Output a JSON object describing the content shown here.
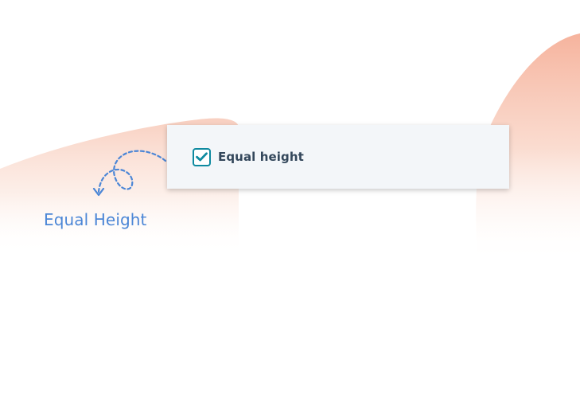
{
  "control": {
    "label": "Equal height",
    "checked": true
  },
  "caption": "Equal Height",
  "colors": {
    "accent": "#0e8aa0",
    "label_text": "#33475b",
    "caption": "#4b86d6",
    "panel_bg": "#f3f6f9",
    "decoration": "#f6b8a2"
  },
  "icons": {
    "checkbox": "check-icon",
    "annotation": "dashed-curved-arrow-icon"
  }
}
